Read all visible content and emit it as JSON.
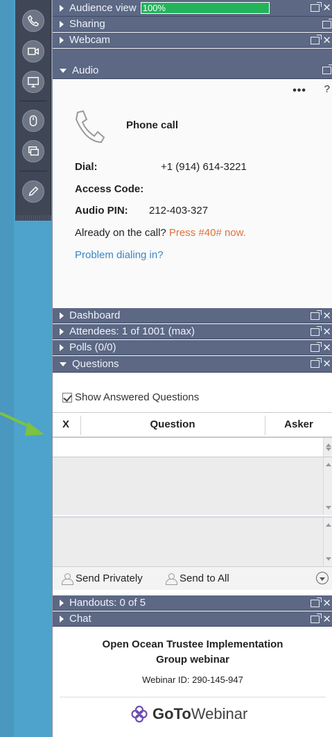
{
  "panel_headers": {
    "audience_view": {
      "label": "Audience view",
      "progress_text": "100%",
      "progress": 1.0
    },
    "sharing": {
      "label": "Sharing"
    },
    "webcam": {
      "label": "Webcam"
    },
    "audio": {
      "label": "Audio"
    },
    "dashboard": {
      "label": "Dashboard"
    },
    "attendees": {
      "label": "Attendees: 1 of 1001 (max)"
    },
    "polls": {
      "label": "Polls (0/0)"
    },
    "questions": {
      "label": "Questions"
    },
    "handouts": {
      "label": "Handouts: 0 of 5"
    },
    "chat": {
      "label": "Chat"
    }
  },
  "audio": {
    "more": "•••",
    "help": "?",
    "title": "Phone call",
    "dial_label": "Dial:",
    "dial_value": "+1 (914) 614-3221",
    "access_code_label": "Access Code:",
    "audio_pin_label": "Audio PIN:",
    "audio_pin_value": "212-403-327",
    "already_text": "Already on the call?",
    "press_text": "Press #40# now.",
    "problem_link": "Problem dialing in?"
  },
  "questions": {
    "show_answered": "Show Answered Questions",
    "col_x": "X",
    "col_question": "Question",
    "col_asker": "Asker",
    "send_privately": "Send Privately",
    "send_to_all": "Send to All"
  },
  "webinar": {
    "title_line1": "Open Ocean Trustee Implementation",
    "title_line2": "Group webinar",
    "id_text": "Webinar ID: 290-145-947",
    "logo_bold": "GoTo",
    "logo_light": "Webinar"
  },
  "colors": {
    "header_bg": "#5c6884",
    "progress_green": "#23b35a",
    "background_blue": "#3a8db5",
    "annotation_arrow": "#7dc241",
    "orange_text": "#e0703a",
    "link_blue": "#3a86c4"
  },
  "toolbar_icons": [
    "phone-icon",
    "camera-icon",
    "screen-icon",
    "mouse-icon",
    "screens-icon",
    "pen-icon"
  ]
}
